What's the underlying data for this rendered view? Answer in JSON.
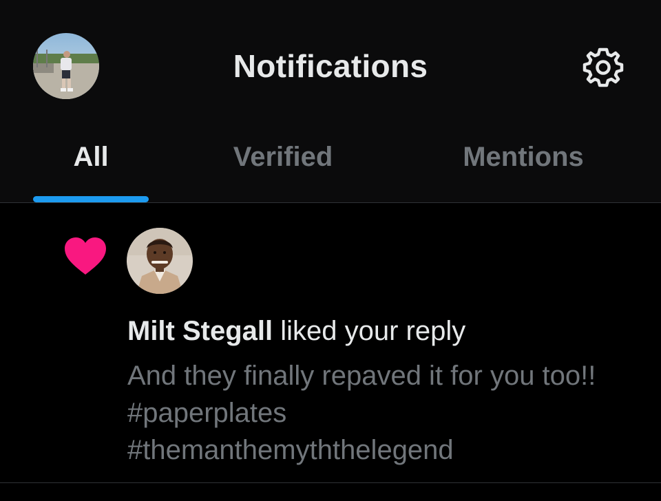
{
  "header": {
    "title": "Notifications",
    "profile_avatar": "profile-avatar-photo",
    "settings_icon": "gear-icon"
  },
  "tabs": [
    {
      "label": "All",
      "active": true
    },
    {
      "label": "Verified",
      "active": false
    },
    {
      "label": "Mentions",
      "active": false
    }
  ],
  "notification": {
    "icon": "heart-icon",
    "icon_color": "#f91880",
    "user_name": "Milt Stegall",
    "action": " liked your reply",
    "quote_lines": [
      "And they finally repaved it for you too!!",
      "#paperplates",
      "#themanthemyththelegend"
    ]
  },
  "colors": {
    "accent": "#1d9bf0",
    "text_primary": "#e7e9ea",
    "text_secondary": "#71767b",
    "like": "#f91880"
  }
}
